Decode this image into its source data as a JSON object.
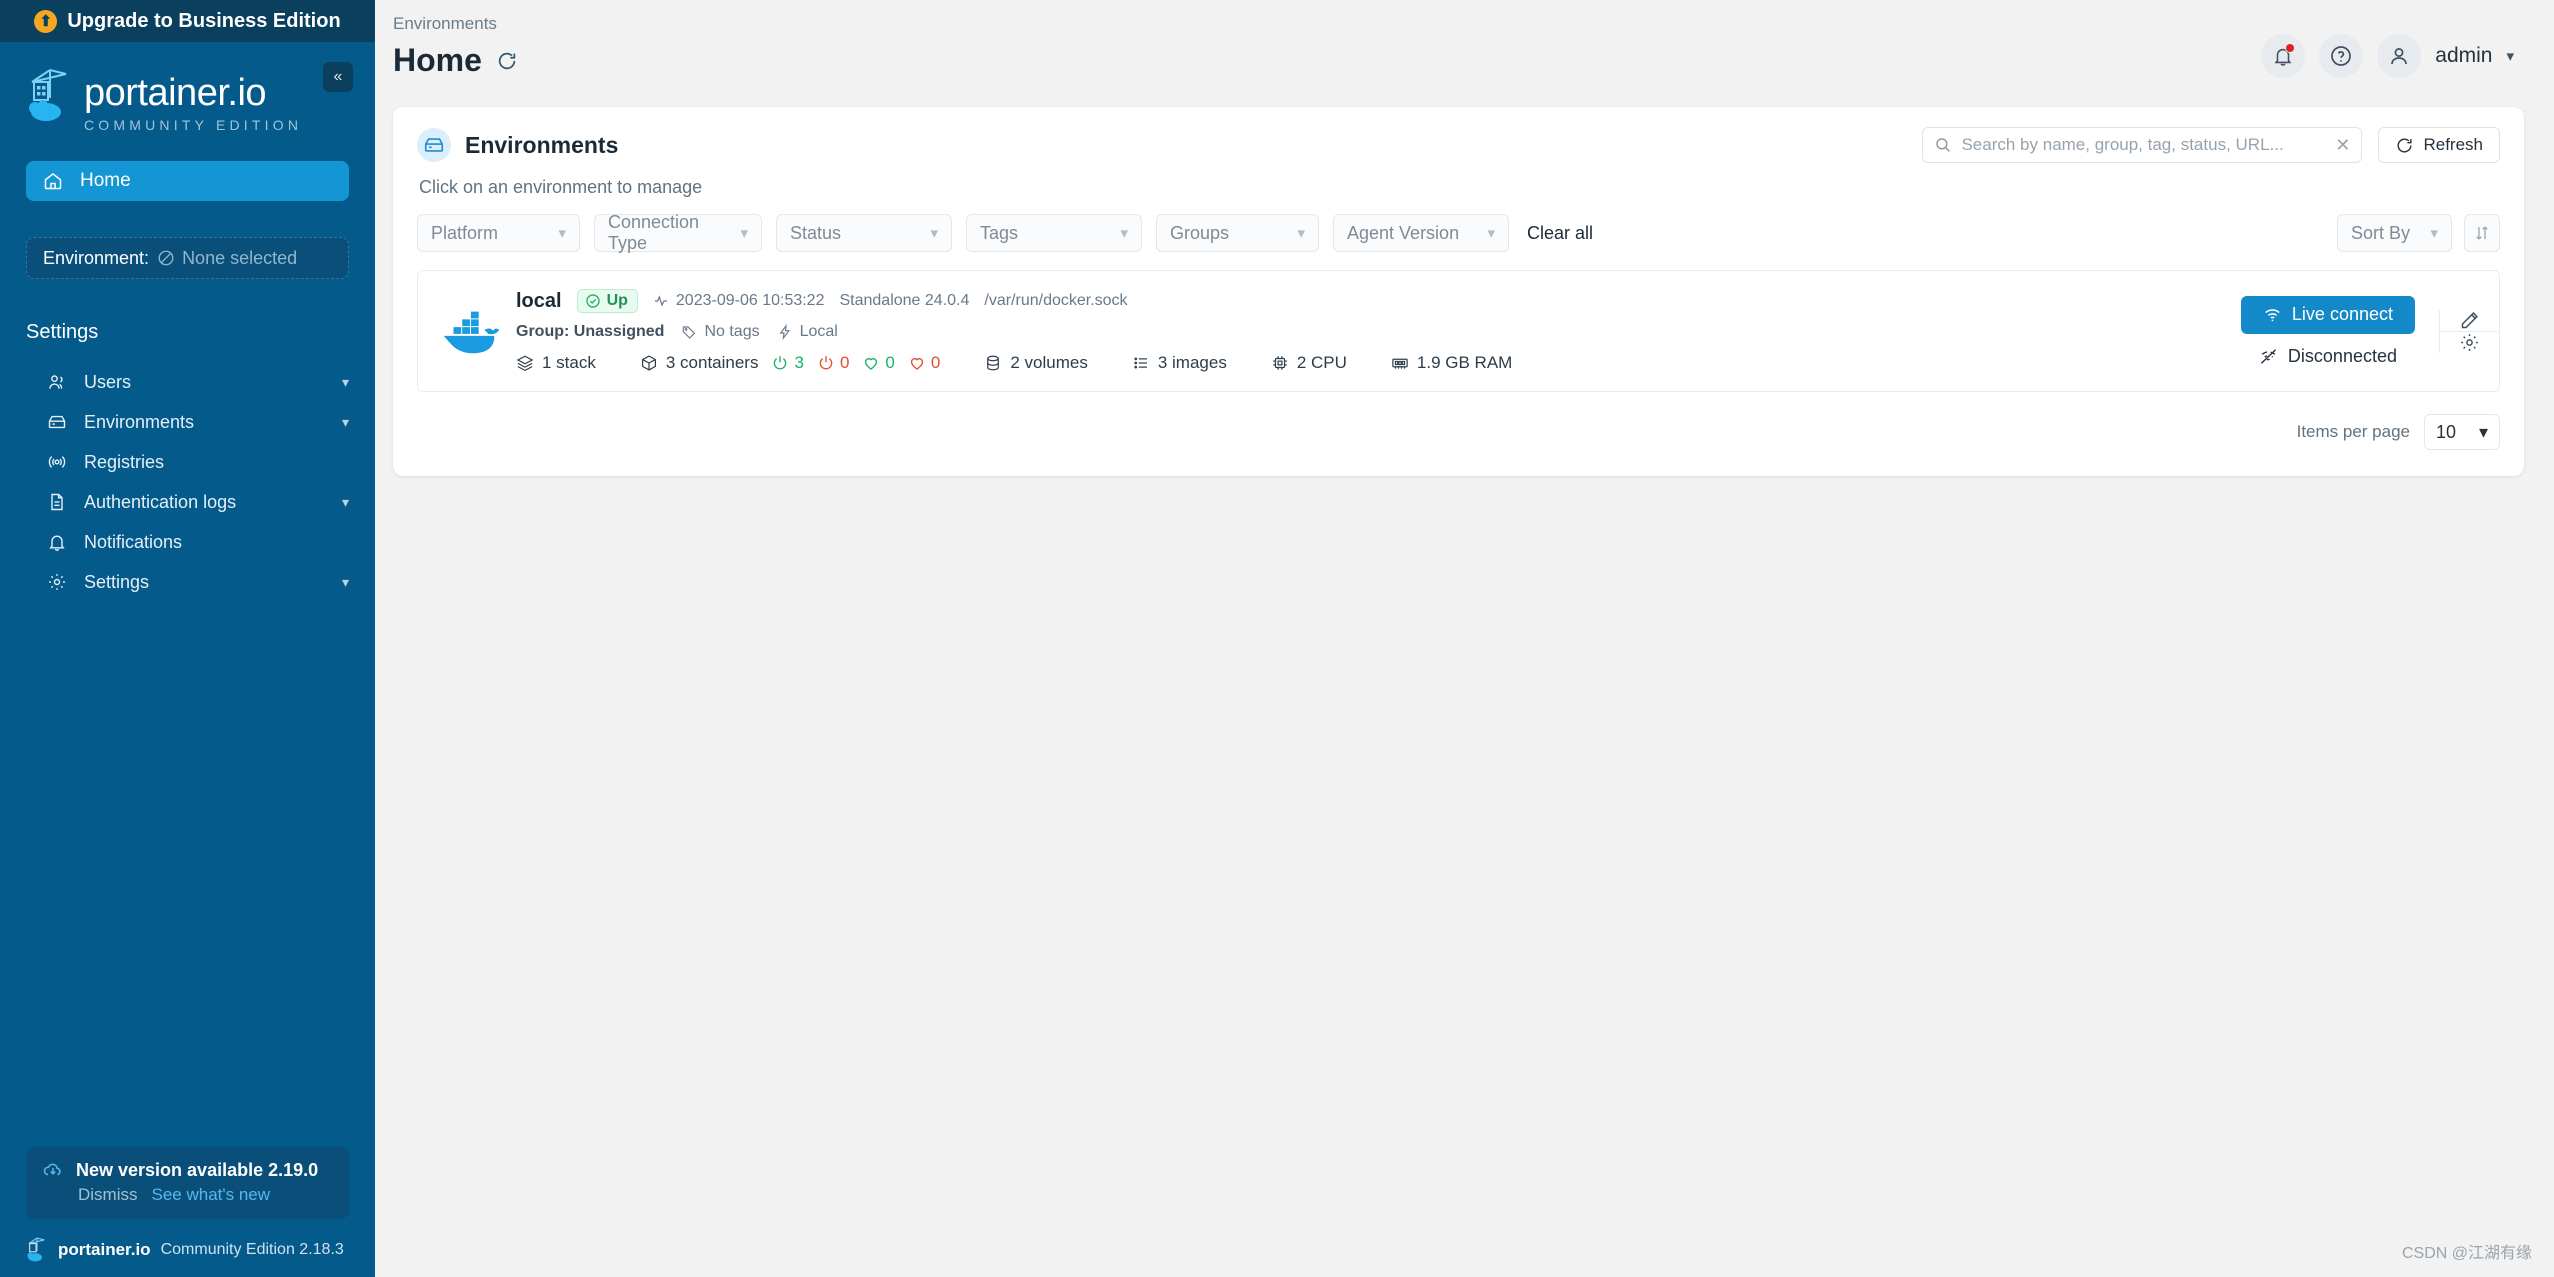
{
  "sidebar": {
    "upgrade_banner": "Upgrade to Business Edition",
    "logo_title": "portainer.io",
    "logo_subtitle": "COMMUNITY EDITION",
    "home_label": "Home",
    "environment_label": "Environment:",
    "environment_value": "None selected",
    "section_label": "Settings",
    "items": [
      {
        "label": "Users",
        "icon": "users-icon",
        "expandable": true
      },
      {
        "label": "Environments",
        "icon": "box-icon",
        "expandable": true
      },
      {
        "label": "Registries",
        "icon": "radio-icon",
        "expandable": false
      },
      {
        "label": "Authentication logs",
        "icon": "file-text-icon",
        "expandable": true
      },
      {
        "label": "Notifications",
        "icon": "bell-icon",
        "expandable": false
      },
      {
        "label": "Settings",
        "icon": "gear-icon",
        "expandable": true
      }
    ],
    "version_notice": {
      "title": "New version available 2.19.0",
      "dismiss": "Dismiss",
      "whats_new": "See what's new"
    },
    "footer": {
      "name": "portainer.io",
      "edition": "Community Edition 2.18.3"
    }
  },
  "header": {
    "breadcrumb": "Environments",
    "title": "Home",
    "user_name": "admin"
  },
  "card": {
    "title": "Environments",
    "subtitle": "Click on an environment to manage",
    "search": {
      "placeholder": "Search by name, group, tag, status, URL...",
      "value": ""
    },
    "refresh_label": "Refresh",
    "filters": [
      {
        "label": "Platform",
        "name": "platform"
      },
      {
        "label": "Connection Type",
        "name": "connection-type"
      },
      {
        "label": "Status",
        "name": "status"
      },
      {
        "label": "Tags",
        "name": "tags"
      },
      {
        "label": "Groups",
        "name": "groups"
      },
      {
        "label": "Agent Version",
        "name": "agent-version"
      }
    ],
    "clear_all": "Clear all",
    "sort_by": "Sort By"
  },
  "environment": {
    "name": "local",
    "status": "Up",
    "heartbeat": "2023-09-06 10:53:22",
    "engine": "Standalone 24.0.4",
    "url": "/var/run/docker.sock",
    "group": "Group: Unassigned",
    "tags": "No tags",
    "connection": "Local",
    "stacks": "1 stack",
    "containers": "3 containers",
    "running": "3",
    "stopped": "0",
    "healthy": "0",
    "unhealthy": "0",
    "volumes": "2 volumes",
    "images": "3 images",
    "cpu": "2 CPU",
    "ram": "1.9 GB RAM",
    "live_connect": "Live connect",
    "connection_state": "Disconnected"
  },
  "pagination": {
    "label": "Items per page",
    "value": "10"
  },
  "watermark": "CSDN @江湖有缘",
  "colors": {
    "sidebar": "#055a8c",
    "banner": "#0a3f5e",
    "accent": "#1389c9",
    "active_nav": "#1496d4",
    "status_up": "#1f9254",
    "danger": "#e0502a"
  }
}
